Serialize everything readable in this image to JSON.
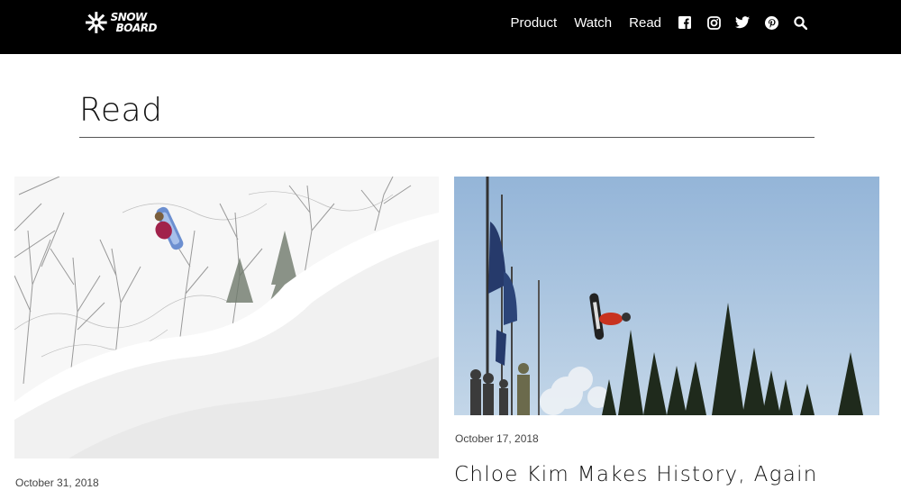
{
  "header": {
    "logo_line1": "SNOW",
    "logo_line2": "BOARD",
    "nav": [
      "Product",
      "Watch",
      "Read"
    ],
    "social_icons": [
      "facebook-icon",
      "instagram-icon",
      "twitter-icon",
      "pinterest-icon",
      "search-icon"
    ]
  },
  "page": {
    "title": "Read"
  },
  "articles": [
    {
      "date": "October 31, 2018",
      "title": ""
    },
    {
      "date": "October 17, 2018",
      "title": "Chloe Kim Makes History, Again"
    }
  ],
  "colors": {
    "header_bg": "#000000",
    "sky": "#a9c4de",
    "snow": "#f4f4f4"
  }
}
